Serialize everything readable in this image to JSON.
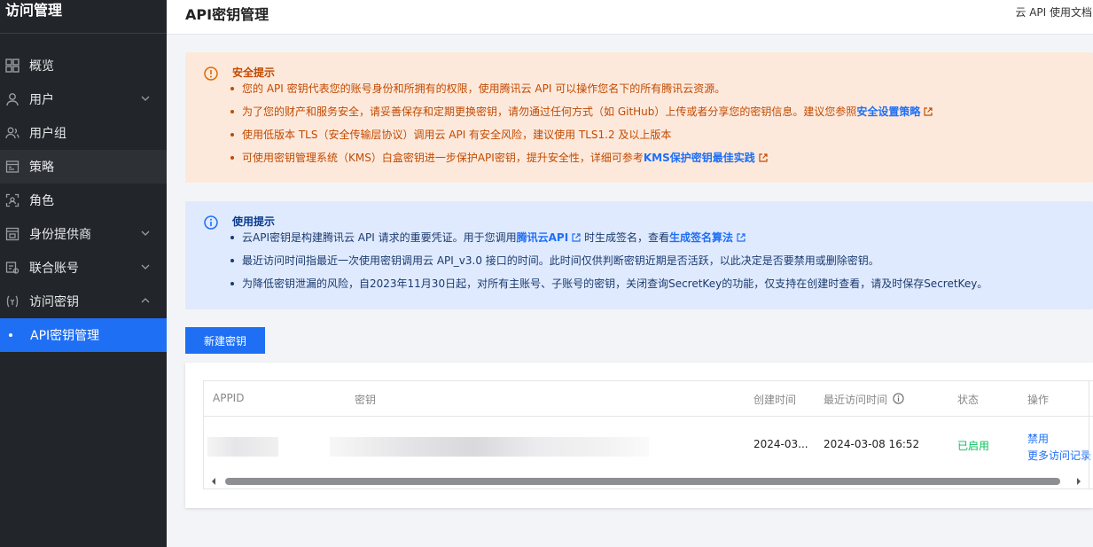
{
  "sidebar": {
    "title": "访问管理",
    "items": [
      {
        "label": "概览",
        "icon": "grid-icon"
      },
      {
        "label": "用户",
        "icon": "user-icon",
        "chevron": "down"
      },
      {
        "label": "用户组",
        "icon": "user-group-icon"
      },
      {
        "label": "策略",
        "icon": "policy-icon"
      },
      {
        "label": "角色",
        "icon": "role-icon"
      },
      {
        "label": "身份提供商",
        "icon": "identity-provider-icon",
        "chevron": "down"
      },
      {
        "label": "联合账号",
        "icon": "federated-account-icon",
        "chevron": "down"
      },
      {
        "label": "访问密钥",
        "icon": "access-key-icon",
        "chevron": "up"
      },
      {
        "label": "API密钥管理",
        "active": true
      }
    ]
  },
  "header": {
    "title": "API密钥管理",
    "doc_link": "云 API 使用文档"
  },
  "warning": {
    "title": "安全提示",
    "items": [
      {
        "text": "您的 API 密钥代表您的账号身份和所拥有的权限，使用腾讯云 API 可以操作您名下的所有腾讯云资源。"
      },
      {
        "text": "为了您的财产和服务安全，请妥善保存和定期更换密钥，请勿通过任何方式（如 GitHub）上传或者分享您的密钥信息。建议您参照",
        "link": "安全设置策略"
      },
      {
        "text": "使用低版本 TLS（安全传输层协议）调用云 API 有安全风险，建议使用 TLS1.2 及以上版本"
      },
      {
        "text": "可使用密钥管理系统（KMS）白盒密钥进一步保护API密钥，提升安全性，详细可参考",
        "link": "KMS保护密钥最佳实践"
      }
    ]
  },
  "info": {
    "title": "使用提示",
    "items": [
      {
        "pre": "云API密钥是构建腾讯云 API 请求的重要凭证。用于您调用",
        "link1": "腾讯云API",
        "mid": "时生成签名，查看",
        "link2": "生成签名算法"
      },
      {
        "text": "最近访问时间指最近一次使用密钥调用云 API_v3.0 接口的时间。此时间仅供判断密钥近期是否活跃，以此决定是否要禁用或删除密钥。"
      },
      {
        "text": "为降低密钥泄漏的风险，自2023年11月30日起，对所有主账号、子账号的密钥，关闭查询SecretKey的功能，仅支持在创建时查看，请及时保存SecretKey。"
      }
    ]
  },
  "new_key_button": "新建密钥",
  "table": {
    "headers": {
      "appid": "APPID",
      "key": "密钥",
      "created": "创建时间",
      "last_access": "最近访问时间",
      "status": "状态",
      "actions": "操作"
    },
    "rows": [
      {
        "created": "2024-03...",
        "last_access": "2024-03-08 16:52",
        "status": "已启用",
        "action_disable": "禁用",
        "action_more": "更多访问记录"
      }
    ]
  },
  "colors": {
    "sidebar_bg": "#222529",
    "accent": "#1f6ff5",
    "warning_bg": "#fde9dc",
    "warning_text": "#c14a00",
    "info_bg": "#dfeaff",
    "status_enabled": "#0abf5b"
  }
}
